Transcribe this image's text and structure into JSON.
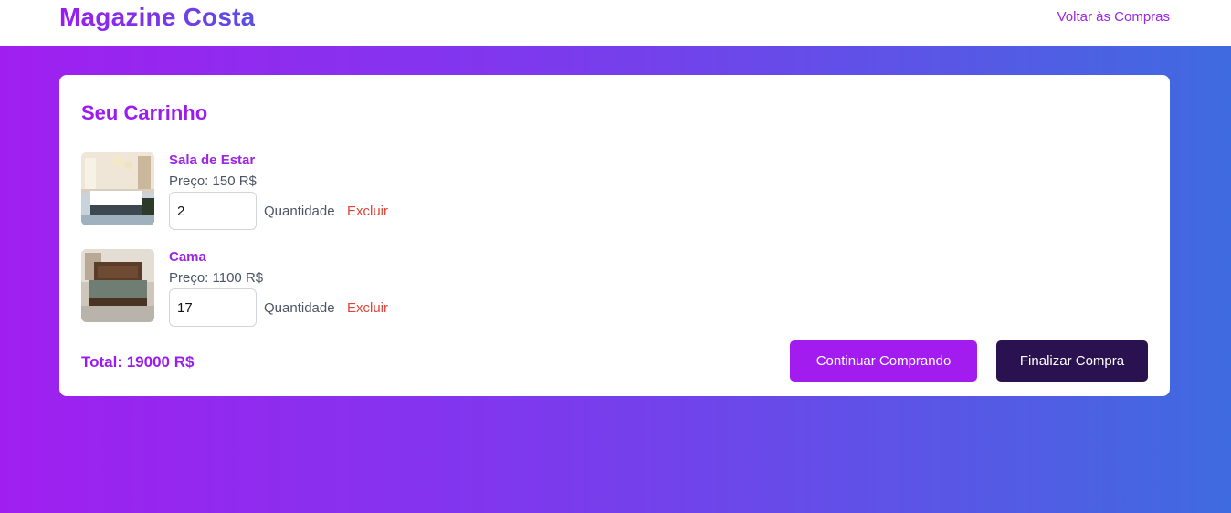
{
  "header": {
    "brand": "Magazine Costa",
    "back_link": "Voltar às Compras"
  },
  "cart": {
    "title": "Seu Carrinho",
    "items": [
      {
        "name": "Sala de Estar",
        "price": "Preço: 150 R$",
        "quantity": "2",
        "quantity_label": "Quantidade",
        "remove_label": "Excluir",
        "image": "living-room-photo"
      },
      {
        "name": "Cama",
        "price": "Preço: 1100 R$",
        "quantity": "17",
        "quantity_label": "Quantidade",
        "remove_label": "Excluir",
        "image": "bed-photo"
      }
    ],
    "total": "Total: 19000 R$",
    "continue_label": "Continuar Comprando",
    "finish_label": "Finalizar Compra"
  },
  "colors": {
    "accent": "#a21cf0",
    "finish_button": "#2a1250",
    "remove": "#e0453a",
    "gradient_start": "#a01ff0",
    "gradient_end": "#3f6be0"
  }
}
